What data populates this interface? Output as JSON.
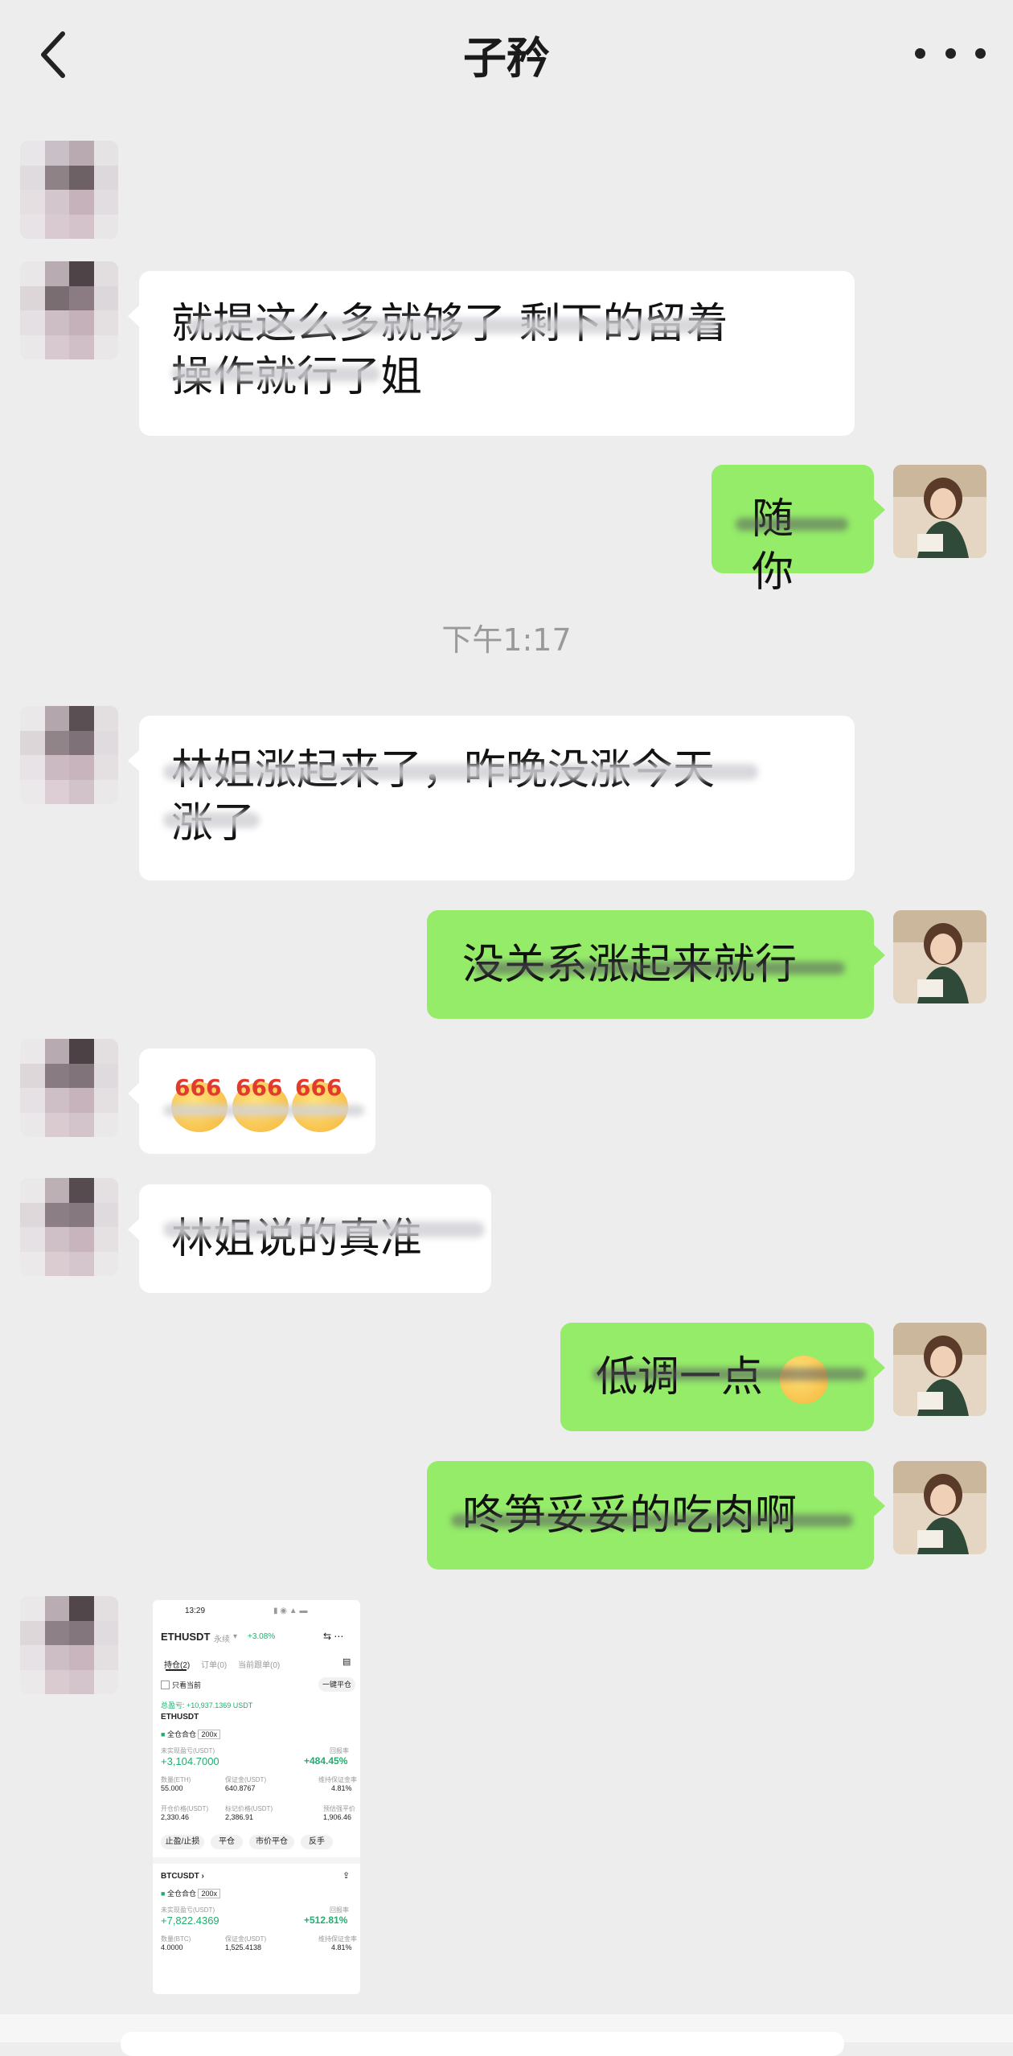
{
  "header": {
    "title": "子矜"
  },
  "messages": {
    "m1": "就提这么多就够了 剩下的留着",
    "m1b": "操作就行了姐",
    "m2": "随你",
    "time": "下午1:17",
    "m3": "林姐涨起来了，昨晚没涨今天",
    "m3b": "涨了",
    "m4": "没关系涨起来就行",
    "m5_label": "666",
    "m6": "林姐说的真准",
    "m7": "低调一点",
    "m8": "咚笋妥妥的吃肉啊"
  },
  "thumb": {
    "time": "13:29",
    "symbol": "ETHUSDT",
    "contract_type": "永续",
    "change": "+3.08%",
    "tab1": "持仓(2)",
    "tab2": "订单(0)",
    "tab3": "当前跟单(0)",
    "only_current": "只看当前",
    "close_all": "一键平仓",
    "total_pnl": "总盈亏: +10,937.1369 USDT",
    "pos1_name": "ETHUSDT",
    "margin_mode": "全仓合仓",
    "leverage": "200x",
    "pnl_label": "未实现盈亏(USDT)",
    "roi_label": "回报率",
    "pos1_pnl": "+3,104.7000",
    "pos1_roi": "+484.45%",
    "qty_label": "数量(ETH)",
    "margin_label": "保证金(USDT)",
    "mmr_label": "维持保证金率",
    "pos1_qty": "55.000",
    "pos1_margin": "640.8767",
    "pos1_mmr": "4.81%",
    "entry_label": "开仓价格(USDT)",
    "mark_label": "标记价格(USDT)",
    "liq_label": "预估强平价",
    "pos1_entry": "2,330.46",
    "pos1_mark": "2,386.91",
    "pos1_liq": "1,906.46",
    "btn_tpsl": "止盈/止损",
    "btn_close": "平仓",
    "btn_market_close": "市价平仓",
    "btn_reverse": "反手",
    "pos2_name": "BTCUSDT",
    "pos2_pnl": "+7,822.4369",
    "pos2_roi": "+512.81%",
    "qty_label2": "数量(BTC)",
    "pos2_qty": "4.0000",
    "pos2_margin": "1,525.4138",
    "pos2_mmr": "4.81%"
  }
}
